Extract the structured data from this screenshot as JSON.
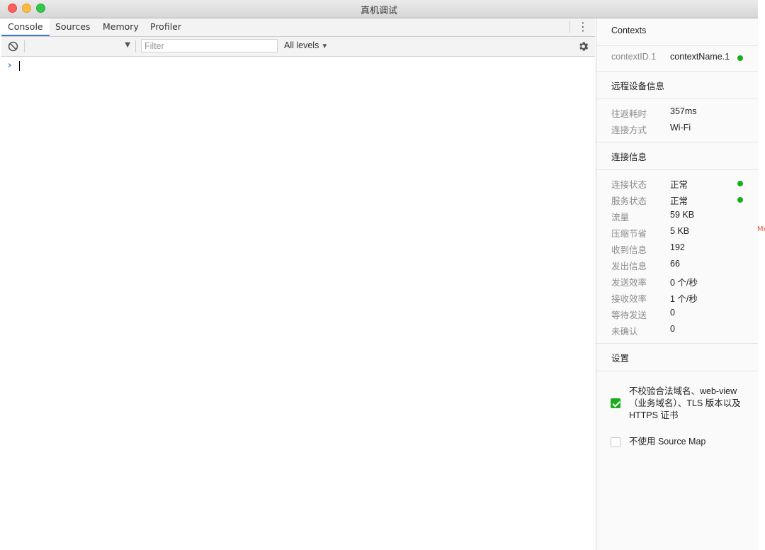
{
  "window": {
    "title": "真机调试"
  },
  "tabs": [
    {
      "label": "Console",
      "active": true
    },
    {
      "label": "Sources",
      "active": false
    },
    {
      "label": "Memory",
      "active": false
    },
    {
      "label": "Profiler",
      "active": false
    }
  ],
  "toolbar": {
    "filter_placeholder": "Filter",
    "levels_label": "All levels",
    "icons": [
      "clear-console-icon",
      "chevron-down-icon",
      "gear-icon",
      "more-vert-icon"
    ]
  },
  "console": {
    "prompt_glyph": "›"
  },
  "right_panel": {
    "contexts": {
      "title": "Contexts",
      "id": "contextID.1",
      "name": "contextName.1",
      "status_color": "#1aad19"
    },
    "remote_device": {
      "title": "远程设备信息",
      "rows": [
        {
          "key": "往返耗时",
          "value": "357ms"
        },
        {
          "key": "连接方式",
          "value": "Wi-Fi"
        }
      ]
    },
    "connection": {
      "title": "连接信息",
      "rows": [
        {
          "key": "连接状态",
          "value": "正常",
          "dot": true
        },
        {
          "key": "服务状态",
          "value": "正常",
          "dot": true
        },
        {
          "key": "流量",
          "value": "59 KB"
        },
        {
          "key": "压缩节省",
          "value": "5 KB"
        },
        {
          "key": "收到信息",
          "value": "192"
        },
        {
          "key": "发出信息",
          "value": "66"
        },
        {
          "key": "发送效率",
          "value": "0 个/秒"
        },
        {
          "key": "接收效率",
          "value": "1 个/秒"
        },
        {
          "key": "等待发送",
          "value": "0"
        },
        {
          "key": "未确认",
          "value": "0"
        }
      ]
    },
    "settings": {
      "title": "设置",
      "options": [
        {
          "label": "不校验合法域名、web-view（业务域名）、TLS 版本以及 HTTPS 证书",
          "checked": true
        },
        {
          "label": "不使用 Source Map",
          "checked": false
        }
      ]
    }
  },
  "colors": {
    "accent": "#3879d9",
    "status_green": "#1aad19"
  },
  "edge_fragment": "Mε"
}
